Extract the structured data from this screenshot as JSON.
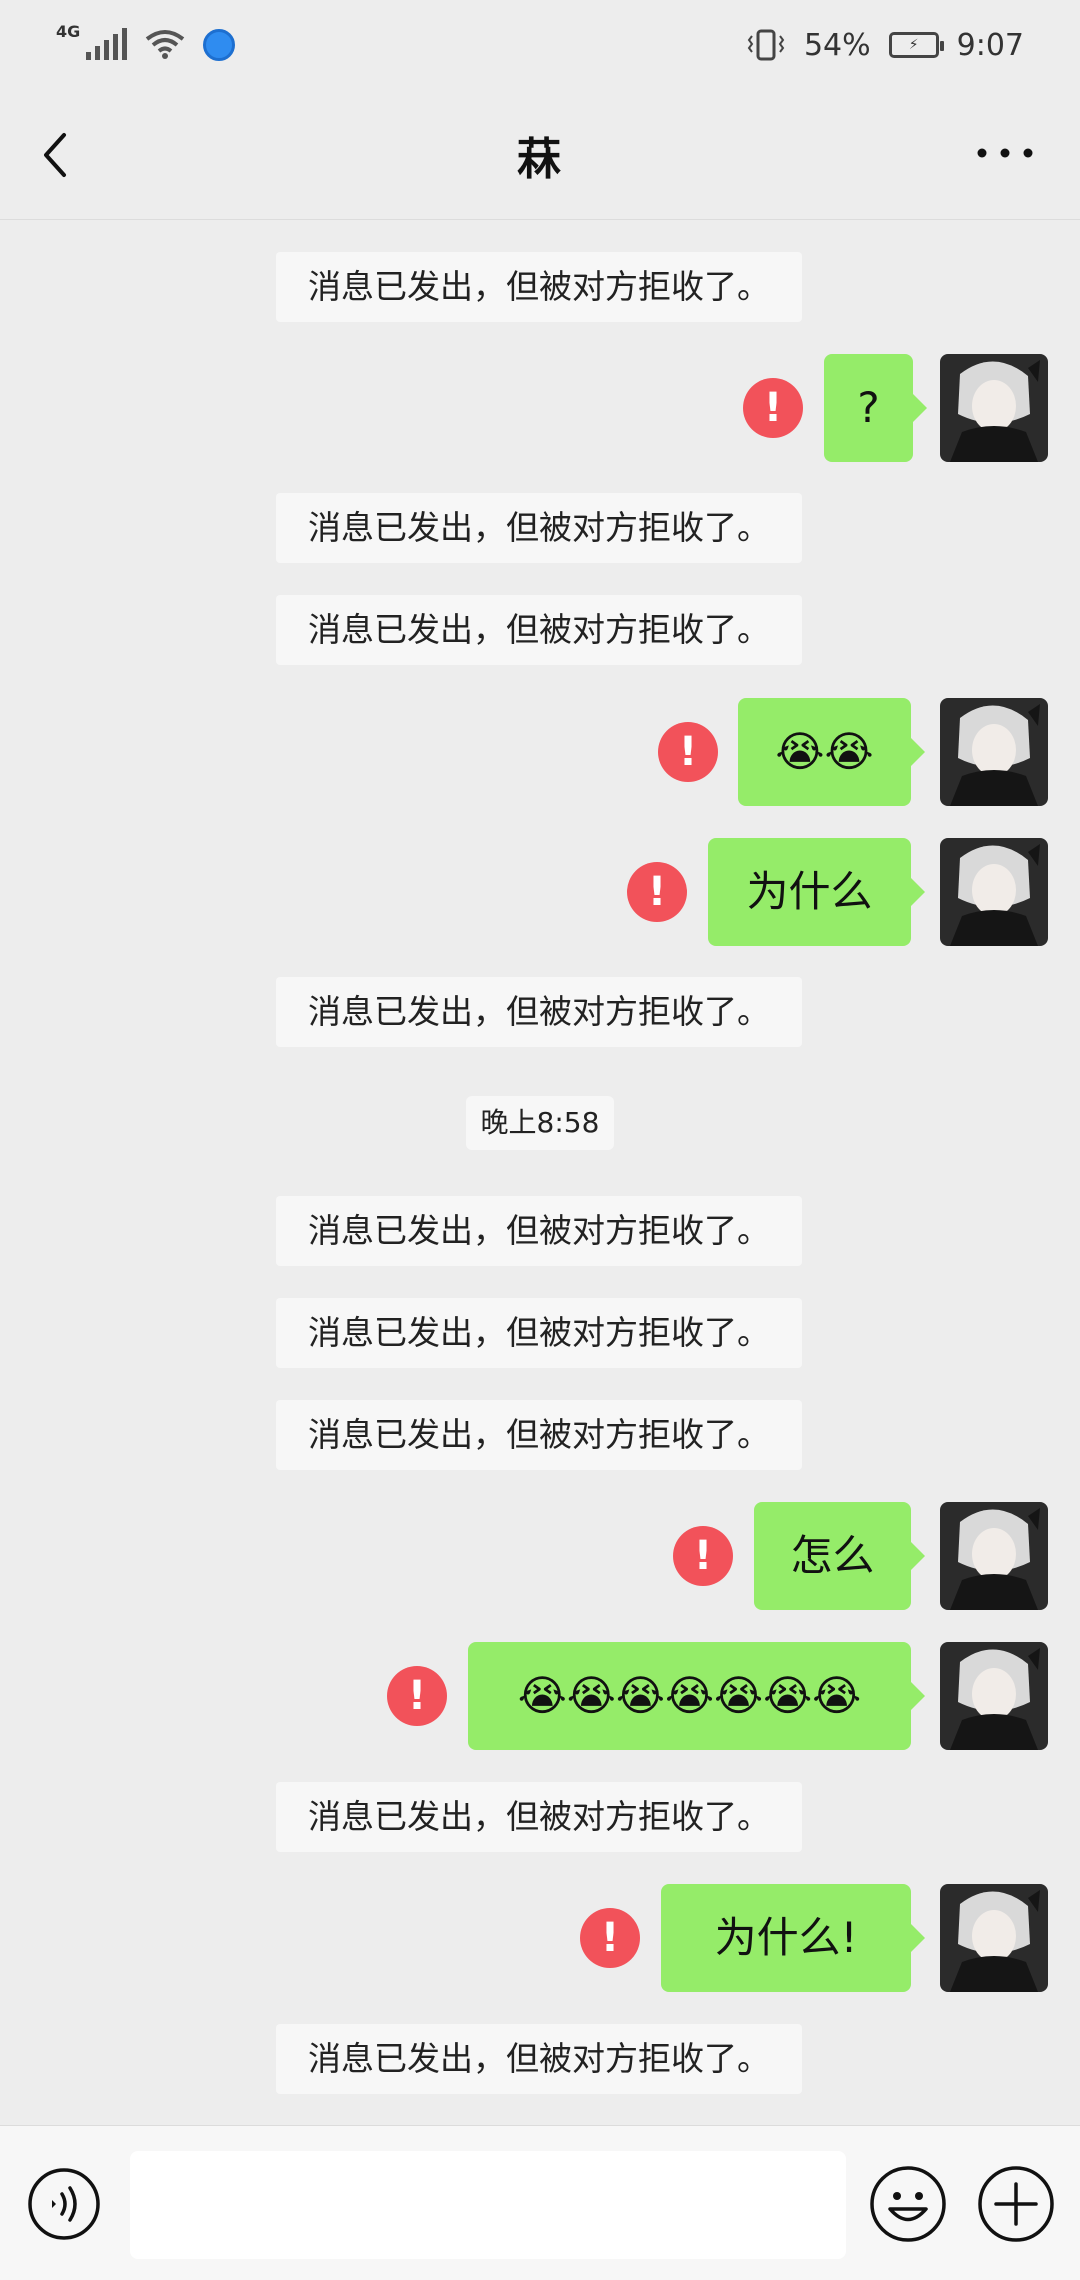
{
  "status_bar": {
    "network": "4G",
    "battery": "54%",
    "time": "9:07"
  },
  "header": {
    "title": "菻"
  },
  "messages": [
    {
      "type": "system",
      "text": "消息已发出，但被对方拒收了。"
    },
    {
      "type": "outgoing",
      "text": "?",
      "failed": true
    },
    {
      "type": "system",
      "text": "消息已发出，但被对方拒收了。"
    },
    {
      "type": "system",
      "text": "消息已发出，但被对方拒收了。"
    },
    {
      "type": "outgoing",
      "text": "😭😭",
      "failed": true
    },
    {
      "type": "outgoing",
      "text": "为什么",
      "failed": true
    },
    {
      "type": "system",
      "text": "消息已发出，但被对方拒收了。"
    },
    {
      "type": "timestamp",
      "text": "晚上8:58"
    },
    {
      "type": "system",
      "text": "消息已发出，但被对方拒收了。"
    },
    {
      "type": "system",
      "text": "消息已发出，但被对方拒收了。"
    },
    {
      "type": "system",
      "text": "消息已发出，但被对方拒收了。"
    },
    {
      "type": "outgoing",
      "text": "怎么",
      "failed": true
    },
    {
      "type": "outgoing",
      "text": "😭😭😭😭😭😭😭",
      "failed": true
    },
    {
      "type": "system",
      "text": "消息已发出，但被对方拒收了。"
    },
    {
      "type": "outgoing",
      "text": "为什么!",
      "failed": true
    },
    {
      "type": "system",
      "text": "消息已发出，但被对方拒收了。"
    }
  ],
  "error_glyph": "!",
  "colors": {
    "background": "#ededed",
    "bubble_outgoing": "#95ec69",
    "error": "#f2525a",
    "system_bg": "#f7f7f7"
  },
  "input_bar": {
    "voice_icon": "voice-icon",
    "emoji_icon": "emoji-icon",
    "plus_icon": "plus-icon",
    "input_value": ""
  }
}
